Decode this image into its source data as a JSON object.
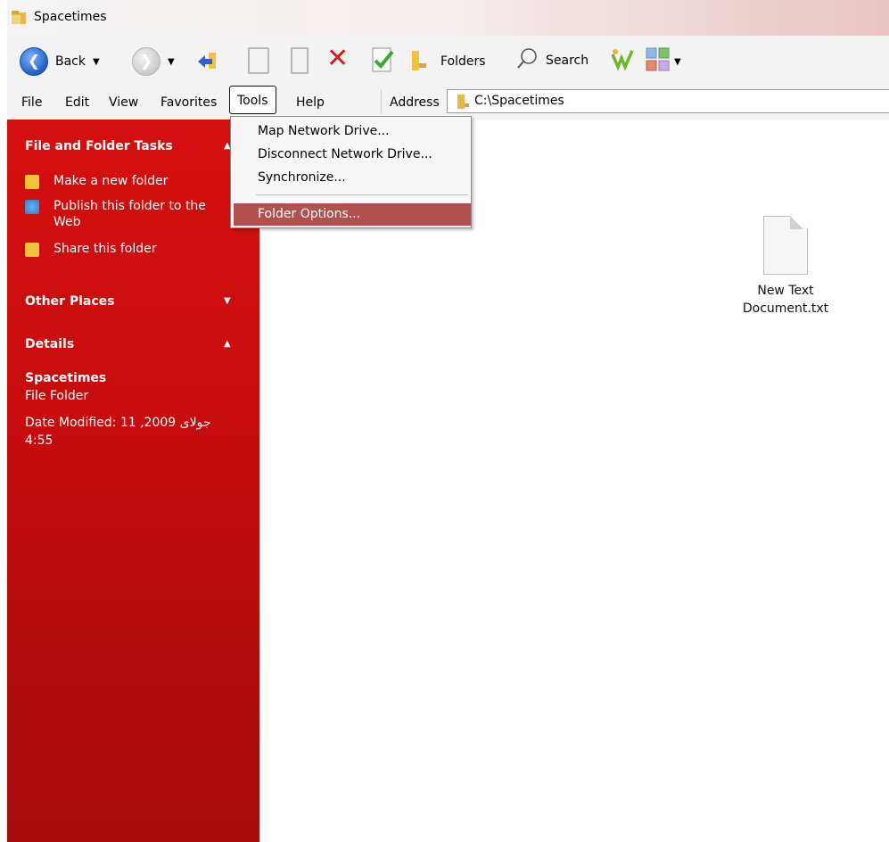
{
  "window": {
    "title": "Spacetimes"
  },
  "toolbar": {
    "back_label": "Back",
    "folders_label": "Folders",
    "search_label": "Search"
  },
  "menubar": {
    "file": "File",
    "edit": "Edit",
    "view": "View",
    "favorites": "Favorites",
    "tools": "Tools",
    "help": "Help"
  },
  "address": {
    "label": "Address",
    "path": "C:\\Spacetimes"
  },
  "tools_menu": {
    "items": [
      "Map Network Drive...",
      "Disconnect Network Drive...",
      "Synchronize...",
      "Folder Options..."
    ],
    "highlighted_index": 3
  },
  "taskpane": {
    "file_tasks": {
      "title": "File and Folder Tasks",
      "links": [
        "Make a new folder",
        "Publish this folder to the Web",
        "Share this folder"
      ]
    },
    "other_places": {
      "title": "Other Places"
    },
    "details": {
      "title": "Details",
      "name": "Spacetimes",
      "type": "File Folder",
      "modified": "Date Modified: 11 جولای 2009, 4:55"
    }
  },
  "files": [
    {
      "name": "New Text Document.txt"
    }
  ],
  "colors": {
    "taskpane_red": "#c50c0c",
    "menu_highlight": "#b25050",
    "title_gradient_end": "#e9c4c4"
  }
}
